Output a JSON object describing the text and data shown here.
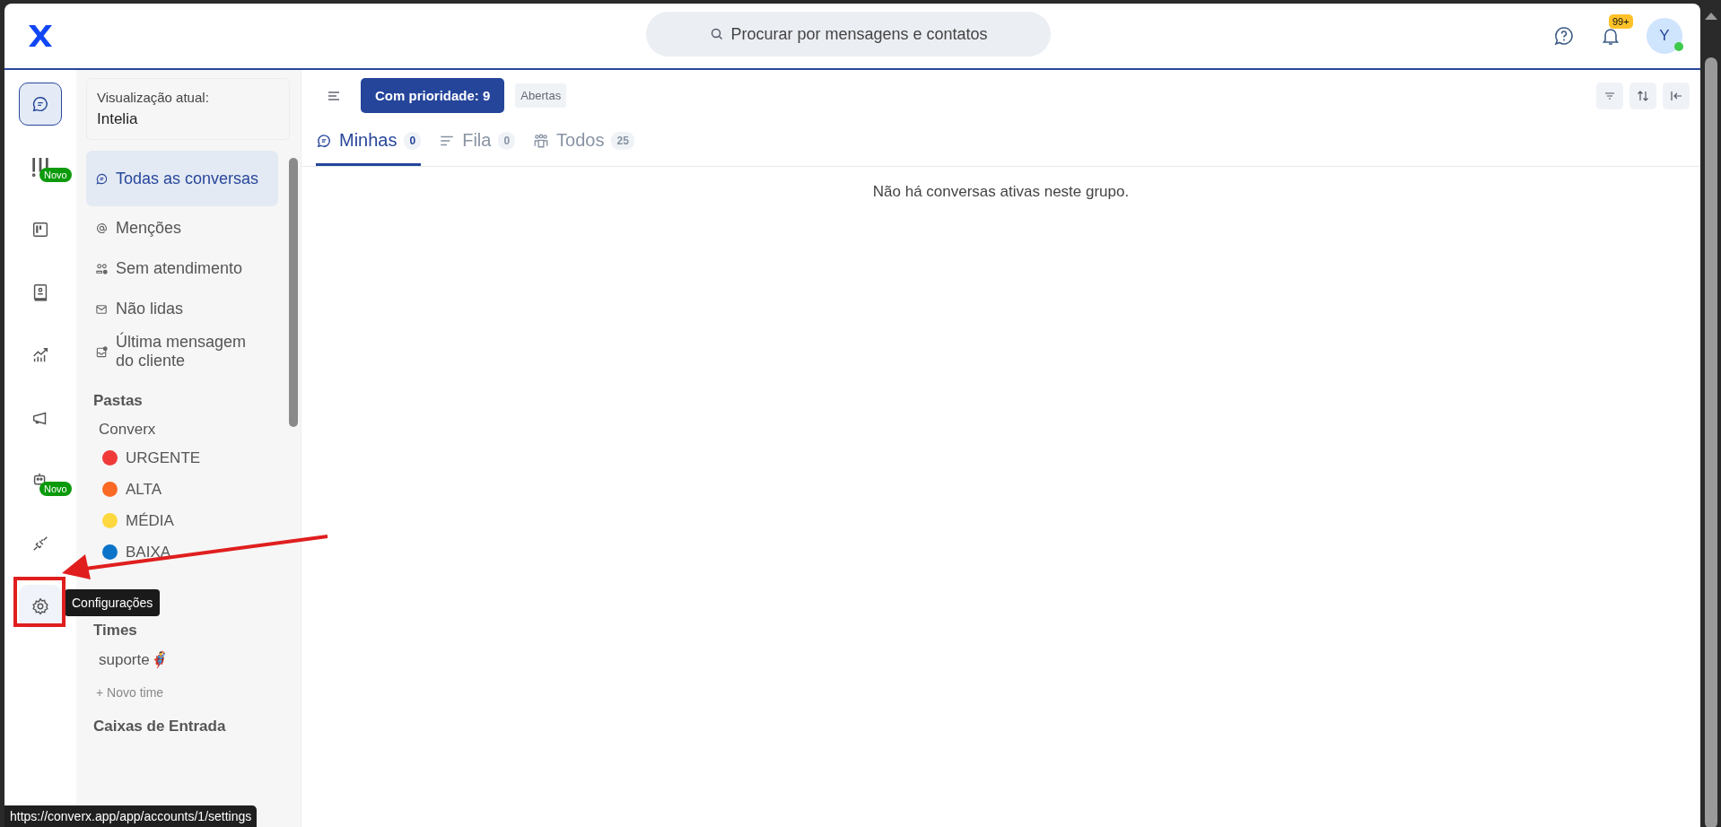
{
  "search": {
    "placeholder": "Procurar por mensagens e contatos"
  },
  "notifications": {
    "badge": "99+"
  },
  "avatar": {
    "initial": "Y",
    "online": true
  },
  "rail": [
    {
      "kind": "chat",
      "selected": true,
      "hovered": false
    },
    {
      "kind": "alert",
      "selected": false,
      "hovered": false,
      "badge": "Novo"
    },
    {
      "kind": "board",
      "selected": false,
      "hovered": false
    },
    {
      "kind": "contacts",
      "selected": false,
      "hovered": false
    },
    {
      "kind": "chart",
      "selected": false,
      "hovered": false
    },
    {
      "kind": "megaphone",
      "selected": false,
      "hovered": false
    },
    {
      "kind": "robot",
      "selected": false,
      "hovered": false,
      "badge": "Novo"
    },
    {
      "kind": "plug",
      "selected": false,
      "hovered": false
    },
    {
      "kind": "gear",
      "selected": false,
      "hovered": true
    }
  ],
  "view": {
    "label": "Visualização atual:",
    "value": "Intelia"
  },
  "menu": [
    {
      "kind": "chat",
      "label": "Todas as conversas",
      "selected": true
    },
    {
      "kind": "at",
      "label": "Menções",
      "selected": false
    },
    {
      "kind": "people",
      "label": "Sem atendimento",
      "selected": false
    },
    {
      "kind": "mail",
      "label": "Não lidas",
      "selected": false
    },
    {
      "kind": "inbox",
      "label": "Última mensagem do cliente",
      "selected": false
    }
  ],
  "folders": {
    "title": "Pastas",
    "group": "Converx",
    "items": [
      {
        "label": "URGENTE",
        "color": "#f03a3a"
      },
      {
        "label": "ALTA",
        "color": "#fb6a24"
      },
      {
        "label": "MÉDIA",
        "color": "#fdd83e"
      },
      {
        "label": "BAIXA",
        "color": "#0b74c8"
      }
    ]
  },
  "teams": {
    "title": "Times",
    "items": [
      "suporte🦸‍♂️"
    ],
    "add": "+ Novo time"
  },
  "inboxes": {
    "title": "Caixas de Entrada"
  },
  "toolbar": {
    "priority": "Com prioridade: 9",
    "status": "Abertas"
  },
  "tabs": [
    {
      "kind": "chat",
      "label": "Minhas",
      "count": "0",
      "selected": true
    },
    {
      "kind": "lines",
      "label": "Fila",
      "count": "0",
      "selected": false
    },
    {
      "kind": "group",
      "label": "Todos",
      "count": "25",
      "selected": false
    }
  ],
  "empty": "Não há conversas ativas neste grupo.",
  "tooltip": "Configurações",
  "status_url": "https://converx.app/app/accounts/1/settings"
}
